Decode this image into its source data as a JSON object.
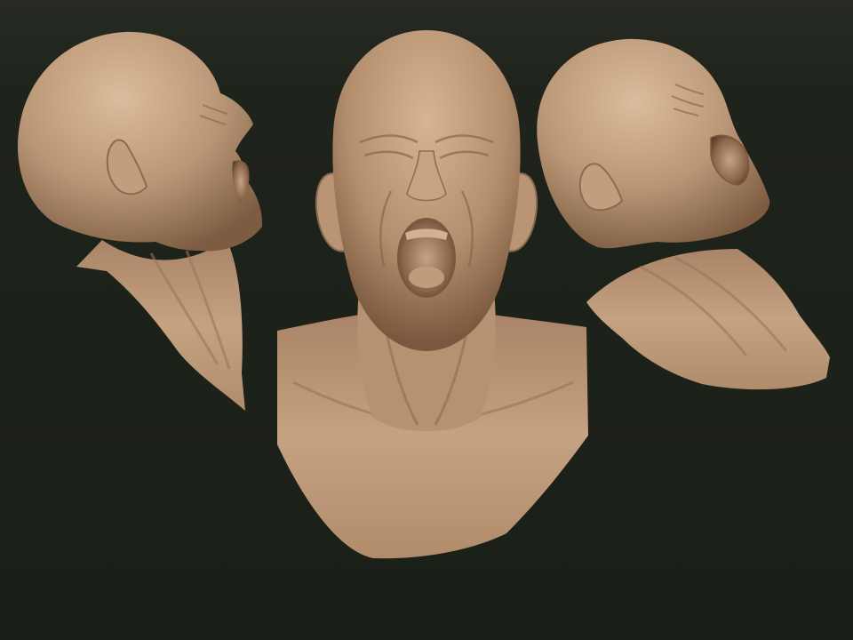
{
  "scene": {
    "background_color": "#1c2119",
    "background_top_color": "#232720",
    "clay_color": "#b89574",
    "clay_light_color": "#d7b594",
    "clay_shadow_color": "#7a5a40",
    "views": [
      {
        "name": "left-profile-view",
        "angle": "profile"
      },
      {
        "name": "front-view",
        "angle": "front"
      },
      {
        "name": "right-three-quarter-view",
        "angle": "three-quarter"
      }
    ]
  }
}
